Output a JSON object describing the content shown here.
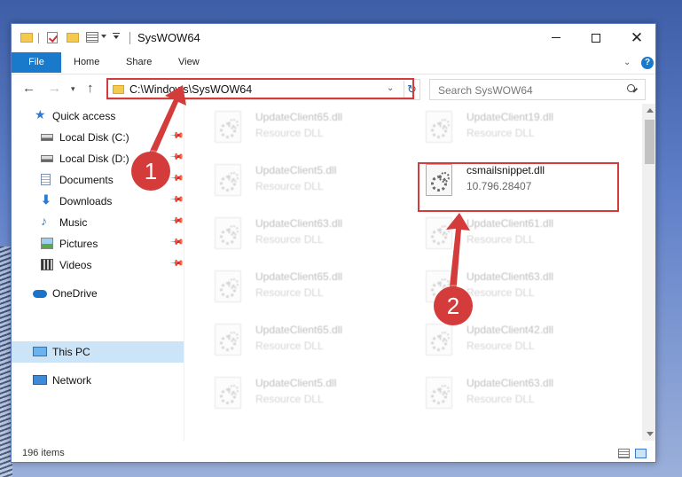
{
  "window": {
    "title": "SysWOW64",
    "min_label": "",
    "close_label": "✕"
  },
  "ribbon": {
    "file": "File",
    "home": "Home",
    "share": "Share",
    "view": "View",
    "help": "?"
  },
  "nav": {
    "address": "C:\\Windows\\SysWOW64",
    "search_placeholder": "Search SysWOW64"
  },
  "sidebar": {
    "items": [
      {
        "label": "Quick access",
        "icon": "star-icon"
      },
      {
        "label": "Local Disk (C:)",
        "icon": "drive-icon",
        "pinned": true
      },
      {
        "label": "Local Disk (D:)",
        "icon": "drive-icon",
        "pinned": true
      },
      {
        "label": "Documents",
        "icon": "documents-icon",
        "pinned": true
      },
      {
        "label": "Downloads",
        "icon": "download-icon",
        "pinned": true
      },
      {
        "label": "Music",
        "icon": "music-icon",
        "pinned": true
      },
      {
        "label": "Pictures",
        "icon": "pictures-icon",
        "pinned": true
      },
      {
        "label": "Videos",
        "icon": "videos-icon",
        "pinned": true
      },
      {
        "label": "OneDrive",
        "icon": "cloud-icon"
      },
      {
        "label": "This PC",
        "icon": "computer-icon",
        "selected": true
      },
      {
        "label": "Network",
        "icon": "network-icon"
      }
    ]
  },
  "files": [
    {
      "name": "UpdateClient65.dll",
      "sub": "Resource DLL"
    },
    {
      "name": "UpdateClient19.dll",
      "sub": "Resource DLL"
    },
    {
      "name": "UpdateClient5.dll",
      "sub": "Resource DLL"
    },
    {
      "name": "csmailsnippet.dll",
      "sub": "10.796.28407"
    },
    {
      "name": "UpdateClient63.dll",
      "sub": "Resource DLL"
    },
    {
      "name": "UpdateClient61.dll",
      "sub": "Resource DLL"
    },
    {
      "name": "UpdateClient65.dll",
      "sub": "Resource DLL"
    },
    {
      "name": "UpdateClient63.dll",
      "sub": "Resource DLL"
    },
    {
      "name": "UpdateClient65.dll",
      "sub": "Resource DLL"
    },
    {
      "name": "UpdateClient42.dll",
      "sub": "Resource DLL"
    },
    {
      "name": "UpdateClient5.dll",
      "sub": "Resource DLL"
    },
    {
      "name": "UpdateClient63.dll",
      "sub": "Resource DLL"
    }
  ],
  "status": {
    "count": "196 items"
  },
  "annotations": {
    "marker1": "1",
    "marker2": "2",
    "color": "#d43b3b"
  }
}
